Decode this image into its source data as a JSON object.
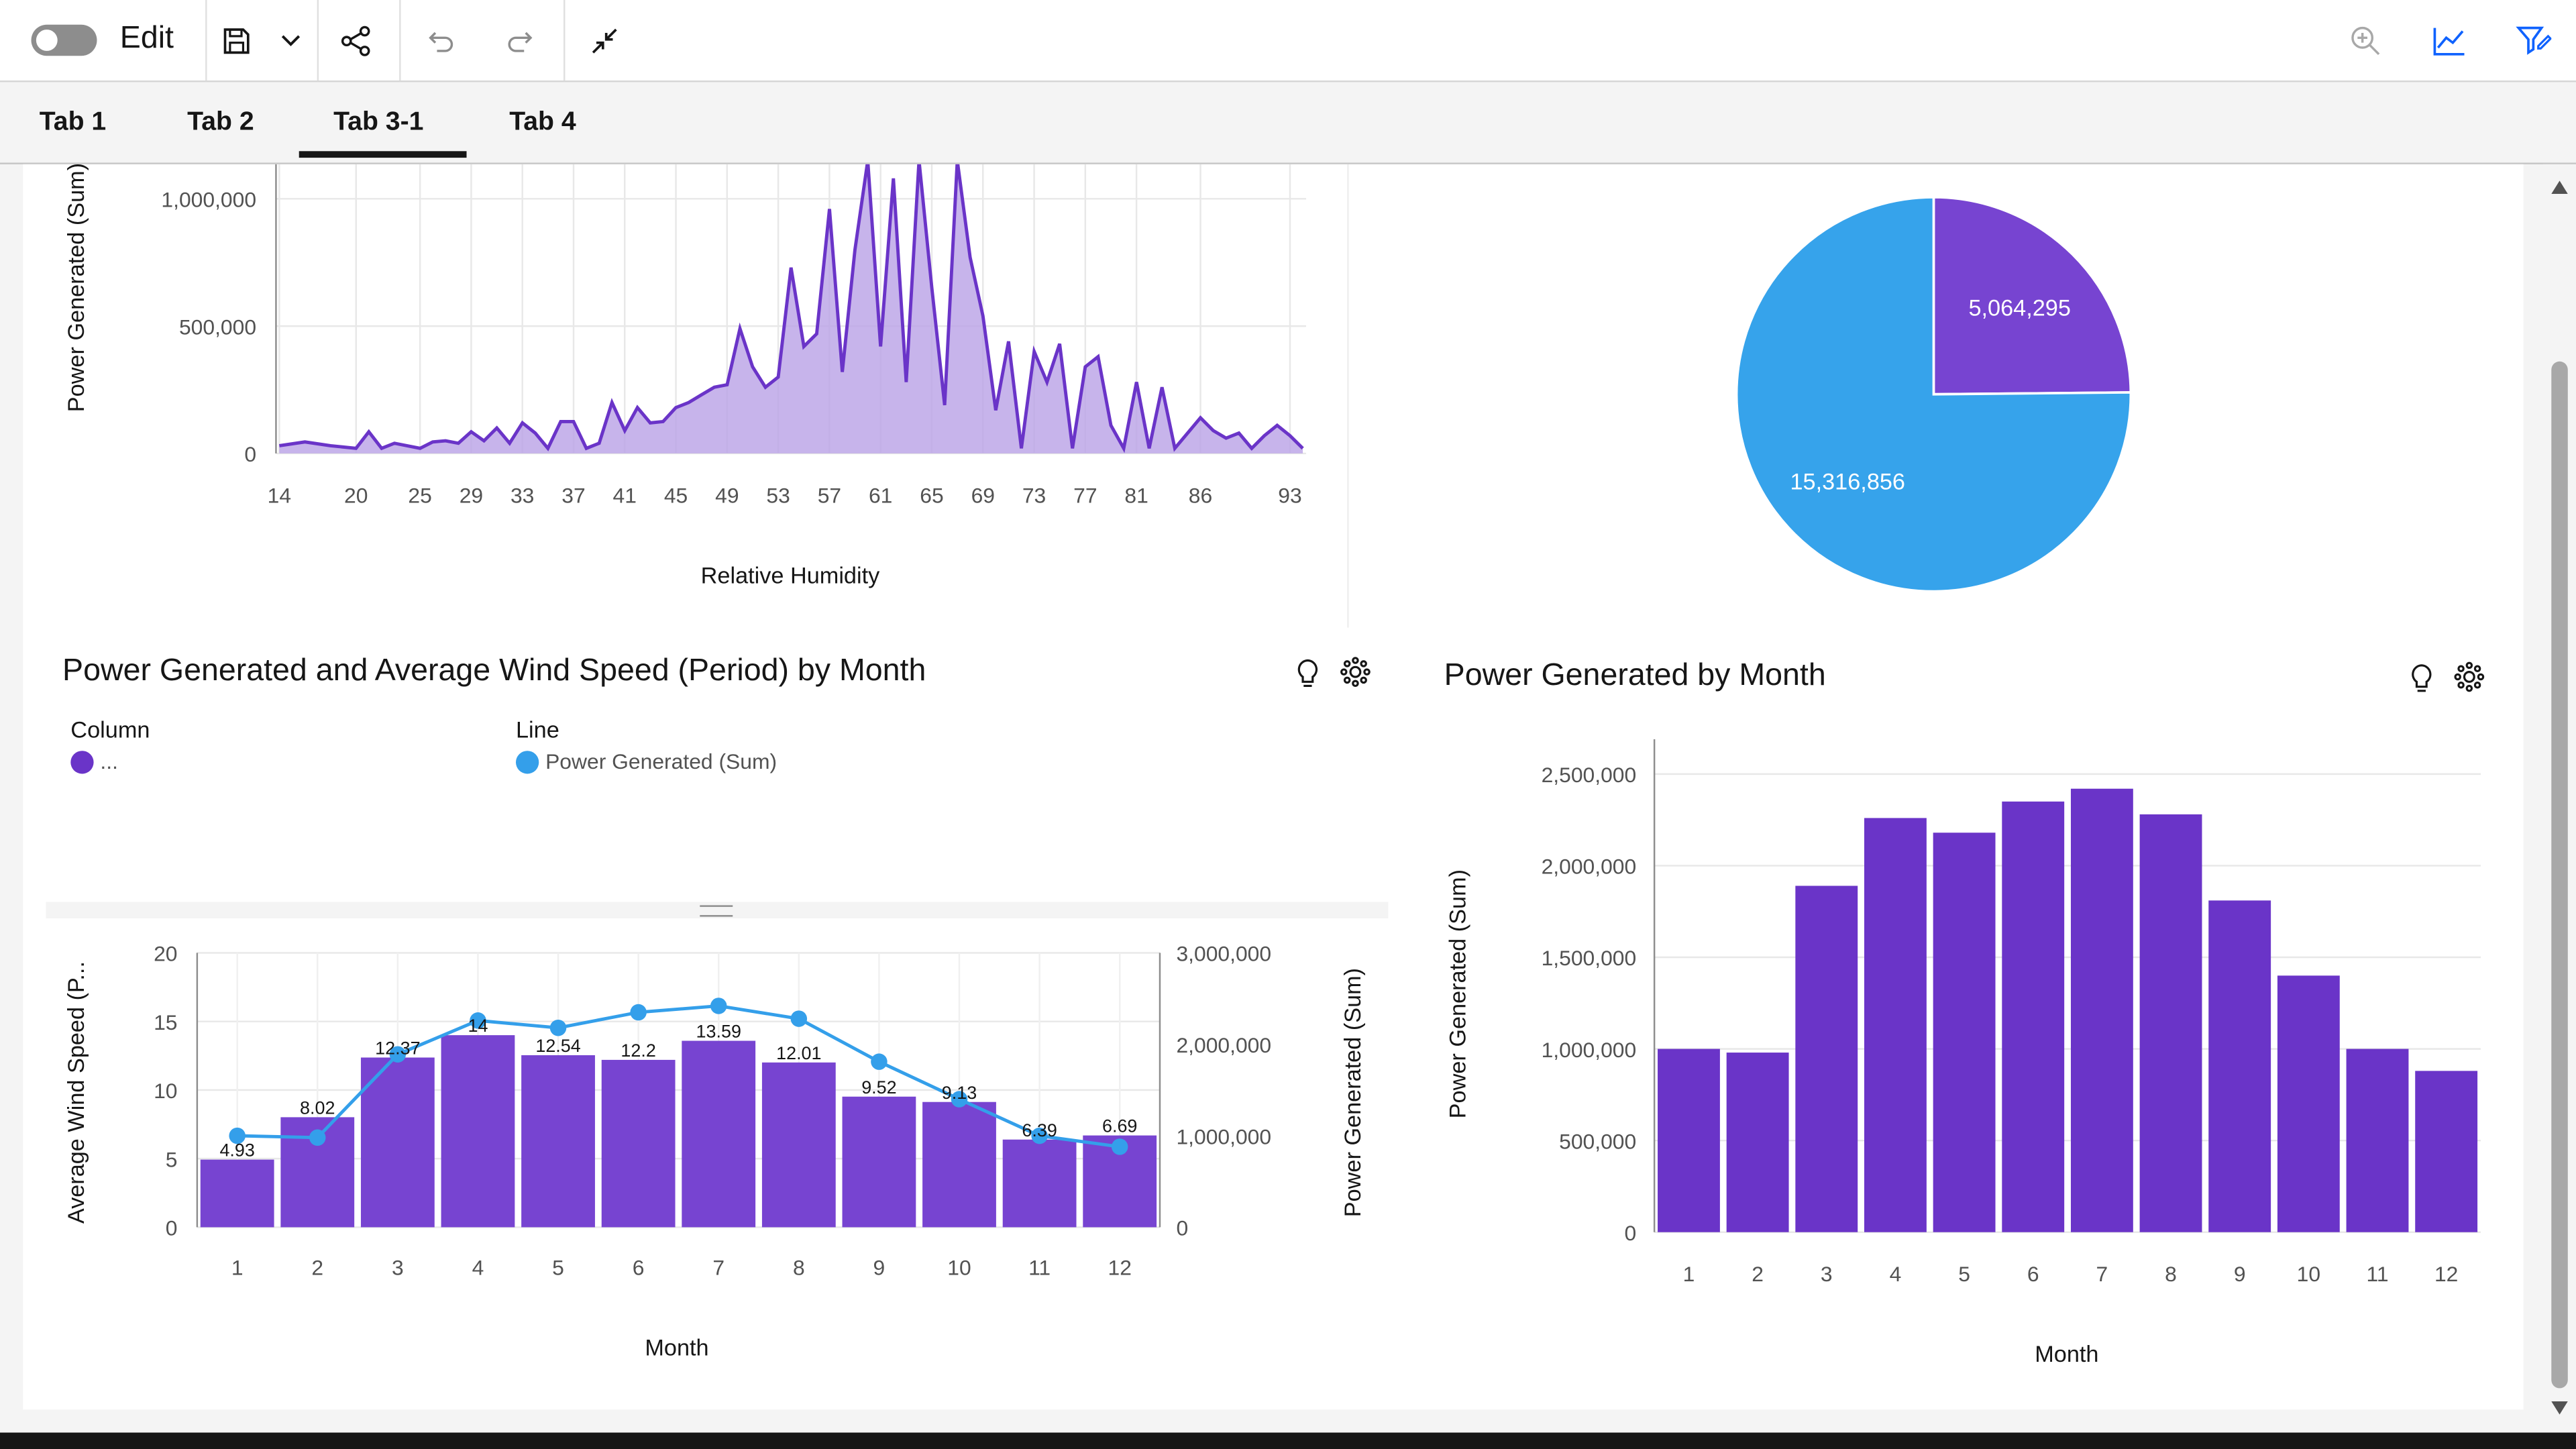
{
  "toolbar": {
    "edit_label": "Edit",
    "icons": [
      "save-icon",
      "chevron-down-icon",
      "share-icon",
      "undo-icon",
      "redo-icon",
      "collapse-icon",
      "zoom-icon",
      "line-chart-icon",
      "filter-icon"
    ]
  },
  "tabs": [
    {
      "label": "Tab 1"
    },
    {
      "label": "Tab 2"
    },
    {
      "label": "Tab 3-1",
      "active": true
    },
    {
      "label": "Tab 4"
    }
  ],
  "colors": {
    "purple": "#6a34c8",
    "purple_fill": "#b9a1e6",
    "blue": "#349fea",
    "pie_purple": "#7744d1",
    "pie_blue": "#36a3eb"
  },
  "area_chart": {
    "ylabel": "Power Generated (Sum)",
    "xlabel": "Relative Humidity",
    "y_ticks": [
      "0",
      "500,000",
      "1,000,000"
    ],
    "x_ticks": [
      "14",
      "20",
      "25",
      "29",
      "33",
      "37",
      "41",
      "45",
      "49",
      "53",
      "57",
      "61",
      "65",
      "69",
      "73",
      "77",
      "81",
      "86",
      "93"
    ]
  },
  "pie_chart": {
    "slices": [
      {
        "label": "5,064,295",
        "value": 5064295,
        "color": "#7744d1"
      },
      {
        "label": "15,316,856",
        "value": 15316856,
        "color": "#36a3eb"
      }
    ]
  },
  "combo_chart": {
    "title": "Power Generated and Average Wind Speed (Period) by Month",
    "legend_column_head": "Column",
    "legend_column_item": "...",
    "legend_line_head": "Line",
    "legend_line_item": "Power Generated (Sum)",
    "ylabel_left": "Average Wind Speed (P...",
    "ylabel_right": "Power Generated (Sum)",
    "xlabel": "Month",
    "y_left_ticks": [
      "0",
      "5",
      "10",
      "15",
      "20"
    ],
    "y_right_ticks": [
      "0",
      "1,000,000",
      "2,000,000",
      "3,000,000"
    ]
  },
  "bar_chart": {
    "title": "Power Generated by Month",
    "ylabel": "Power Generated (Sum)",
    "xlabel": "Month",
    "y_ticks": [
      "0",
      "500,000",
      "1,000,000",
      "1,500,000",
      "2,000,000",
      "2,500,000"
    ]
  },
  "chart_data": [
    {
      "type": "area",
      "xlabel": "Relative Humidity",
      "ylabel": "Power Generated (Sum)",
      "ylim": [
        0,
        1150000
      ],
      "x": [
        14,
        16,
        18,
        20,
        21,
        22,
        23,
        25,
        26,
        27,
        28,
        29,
        30,
        31,
        32,
        33,
        34,
        35,
        36,
        37,
        38,
        39,
        40,
        41,
        42,
        43,
        44,
        45,
        46,
        47,
        48,
        49,
        50,
        51,
        52,
        53,
        54,
        55,
        56,
        57,
        58,
        59,
        60,
        61,
        62,
        63,
        64,
        65,
        66,
        67,
        68,
        69,
        70,
        71,
        72,
        73,
        74,
        75,
        76,
        77,
        78,
        79,
        80,
        81,
        82,
        83,
        84,
        86,
        87,
        88,
        89,
        90,
        91,
        92,
        93,
        94
      ],
      "y": [
        30000,
        45000,
        30000,
        20000,
        85000,
        20000,
        40000,
        20000,
        45000,
        50000,
        40000,
        85000,
        50000,
        100000,
        40000,
        120000,
        80000,
        20000,
        125000,
        125000,
        20000,
        40000,
        200000,
        90000,
        180000,
        120000,
        125000,
        180000,
        200000,
        230000,
        260000,
        270000,
        490000,
        340000,
        260000,
        300000,
        730000,
        420000,
        470000,
        960000,
        320000,
        800000,
        1300000,
        420000,
        1080000,
        280000,
        1200000,
        650000,
        190000,
        1300000,
        770000,
        540000,
        170000,
        440000,
        20000,
        400000,
        280000,
        430000,
        20000,
        340000,
        380000,
        110000,
        20000,
        280000,
        20000,
        260000,
        20000,
        140000,
        90000,
        60000,
        80000,
        20000,
        70000,
        110000,
        70000,
        20000
      ]
    },
    {
      "type": "pie",
      "values": [
        5064295,
        15316856
      ],
      "labels": [
        "5,064,295",
        "15,316,856"
      ]
    },
    {
      "type": "bar",
      "title": "Power Generated and Average Wind Speed (Period) by Month",
      "categories": [
        "1",
        "2",
        "3",
        "4",
        "5",
        "6",
        "7",
        "8",
        "9",
        "10",
        "11",
        "12"
      ],
      "xlabel": "Month",
      "series": [
        {
          "values": [
            4.93,
            8.02,
            12.37,
            14,
            12.54,
            12.2,
            13.59,
            12.01,
            9.52,
            9.13,
            6.39,
            6.69
          ],
          "axis": "left",
          "ylim": [
            0,
            20
          ]
        },
        {
          "name": "Power Generated (Sum)",
          "type": "line",
          "values": [
            1000000,
            980000,
            1890000,
            2260000,
            2180000,
            2350000,
            2420000,
            2280000,
            1810000,
            1400000,
            1000000,
            880000
          ],
          "axis": "right",
          "ylim": [
            0,
            3000000
          ]
        }
      ]
    },
    {
      "type": "bar",
      "title": "Power Generated by Month",
      "categories": [
        "1",
        "2",
        "3",
        "4",
        "5",
        "6",
        "7",
        "8",
        "9",
        "10",
        "11",
        "12"
      ],
      "xlabel": "Month",
      "ylabel": "Power Generated (Sum)",
      "ylim": [
        0,
        2600000
      ],
      "values": [
        1000000,
        980000,
        1890000,
        2260000,
        2180000,
        2350000,
        2420000,
        2280000,
        1810000,
        1400000,
        1000000,
        880000
      ]
    }
  ]
}
